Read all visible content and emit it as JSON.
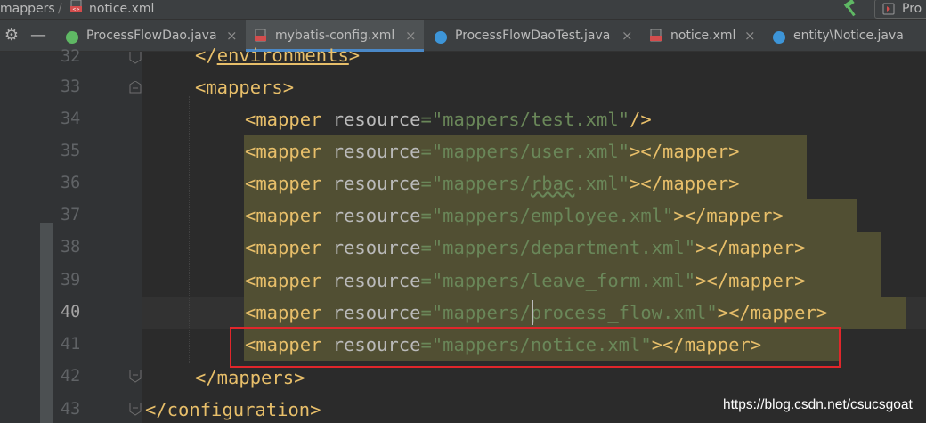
{
  "breadcrumb": {
    "folder": "mappers",
    "separator": "/",
    "file": "notice.xml"
  },
  "toolbar": {
    "build_icon": "hammer-icon",
    "run_config_label": "Pro"
  },
  "tabs": [
    {
      "label": "ProcessFlowDao.java",
      "icon": "interface-icon",
      "color": "#5fb864",
      "active": false
    },
    {
      "label": "mybatis-config.xml",
      "icon": "xml-file-icon",
      "color": "#d34d4d",
      "active": true
    },
    {
      "label": "ProcessFlowDaoTest.java",
      "icon": "test-class-icon",
      "color": "#3d95d8",
      "active": false
    },
    {
      "label": "notice.xml",
      "icon": "xml-file-icon",
      "color": "#d34d4d",
      "active": false
    },
    {
      "label": "entity\\Notice.java",
      "icon": "class-icon",
      "color": "#3d95d8",
      "active": false
    }
  ],
  "tab_close_glyph": "×",
  "gutter": {
    "line_numbers": [
      "32",
      "33",
      "34",
      "35",
      "36",
      "37",
      "38",
      "39",
      "40",
      "41",
      "42",
      "43"
    ],
    "current_line": "40"
  },
  "code": {
    "line32": {
      "open": "</",
      "tag": "environments",
      "close": ">"
    },
    "line33": {
      "open": "<",
      "tag": "mappers",
      "close": ">"
    },
    "line34": {
      "tag": "<mapper",
      "attr": " resource",
      "eq": "=",
      "value": "\"mappers/test.xml\"",
      "close": "/>"
    },
    "line35": {
      "tag": "<mapper",
      "attr": " resource",
      "eq": "=",
      "value": "\"mappers/user.xml\"",
      "close": "></mapper>"
    },
    "line36": {
      "tag": "<mapper",
      "attr": " resource",
      "eq": "=",
      "value_pre": "\"mappers/",
      "value_mid": "rbac",
      "value_post": ".xml\"",
      "close": "></mapper>"
    },
    "line37": {
      "tag": "<mapper",
      "attr": " resource",
      "eq": "=",
      "value": "\"mappers/employee.xml\"",
      "close": "></mapper>"
    },
    "line38": {
      "tag": "<mapper",
      "attr": " resource",
      "eq": "=",
      "value": "\"mappers/department.xml\"",
      "close": "></mapper>"
    },
    "line39": {
      "tag": "<mapper",
      "attr": " resource",
      "eq": "=",
      "value": "\"mappers/leave_form.xml\"",
      "close": "></mapper>"
    },
    "line40": {
      "tag": "<mapper",
      "attr": " resource",
      "eq": "=",
      "value": "\"mappers/process_flow.xml\"",
      "close": "></mapper>"
    },
    "line41": {
      "tag": "<mapper",
      "attr": " resource",
      "eq": "=",
      "value": "\"mappers/notice.xml\"",
      "close": "></mapper>"
    },
    "line42": {
      "text": "</mappers>"
    },
    "line43": {
      "text": "</configuration>"
    }
  },
  "watermark": "https://blog.csdn.net/csucsgoat",
  "colors": {
    "tag": "#e8bf6a",
    "attribute": "#bababa",
    "string": "#6a8759",
    "highlight": "#514f33",
    "annotation_box": "#e0262b",
    "active_tab_underline": "#4a88c7"
  }
}
